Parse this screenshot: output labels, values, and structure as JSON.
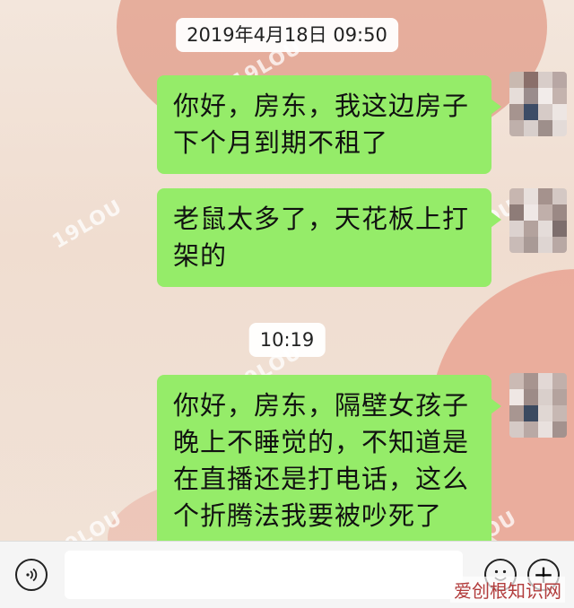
{
  "chat": {
    "timestamps": [
      "2019年4月18日 09:50",
      "10:19"
    ],
    "messages": [
      {
        "sender": "self",
        "text": "你好，房东，我这边房子下个月到期不租了"
      },
      {
        "sender": "self",
        "text": "老鼠太多了，天花板上打架的"
      },
      {
        "sender": "self",
        "text": "你好，房东，隔壁女孩子晚上不睡觉的，不知道是在直播还是打电话，这么个折腾法我要被吵死了"
      }
    ],
    "bubble_color": "#95ec69"
  },
  "watermark": {
    "text": "19LOU"
  },
  "site_mark": {
    "text": "爱创根知识网"
  },
  "bottom_bar": {
    "voice_icon": "voice-icon",
    "emoji_icon": "emoji-icon",
    "plus_icon": "plus-icon",
    "plus_glyph": "+"
  }
}
